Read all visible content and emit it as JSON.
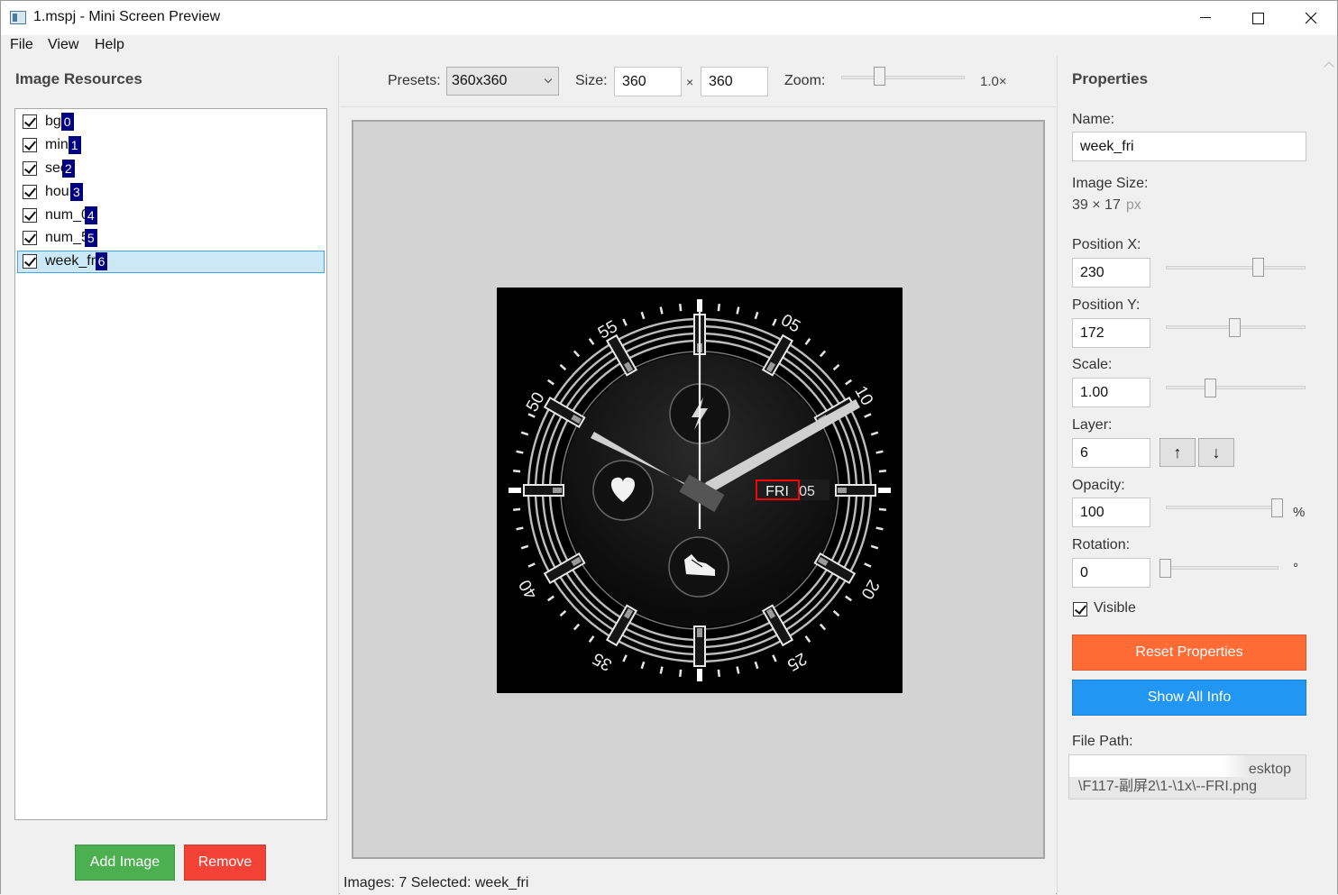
{
  "window": {
    "title": "1.mspj - Mini Screen Preview"
  },
  "menu": [
    "File",
    "View",
    "Help"
  ],
  "left_panel": {
    "title": "Image Resources",
    "items": [
      {
        "label": "bg",
        "index": "0",
        "checked": true
      },
      {
        "label": "min",
        "index": "1",
        "checked": true
      },
      {
        "label": "sec",
        "index": "2",
        "checked": true
      },
      {
        "label": "hour",
        "index": "3",
        "checked": true
      },
      {
        "label": "num_0",
        "index": "4",
        "checked": true
      },
      {
        "label": "num_5",
        "index": "5",
        "checked": true
      },
      {
        "label": "week_fri",
        "index": "6",
        "checked": true,
        "selected": true
      }
    ],
    "add_button": "Add Image",
    "remove_button": "Remove"
  },
  "toolbar": {
    "presets_label": "Presets:",
    "preset_value": "360x360",
    "size_label": "Size:",
    "width": "360",
    "times": "×",
    "height": "360",
    "zoom_label": "Zoom:",
    "zoom_value": "1.0×",
    "zoom_level": 0.3
  },
  "watch": {
    "minute_labels": [
      "05",
      "10",
      "20",
      "25",
      "35",
      "40",
      "50",
      "55"
    ],
    "date_day": "FRI",
    "date_num": "05"
  },
  "status": {
    "text": "Images: 7  Selected: week_fri"
  },
  "properties": {
    "title": "Properties",
    "name_label": "Name:",
    "name_value": "week_fri",
    "image_size_label": "Image Size:",
    "image_size_value": "39 × 17",
    "image_size_unit": "px",
    "pos_x_label": "Position X:",
    "pos_x_value": "230",
    "pos_y_label": "Position Y:",
    "pos_y_value": "172",
    "scale_label": "Scale:",
    "scale_value": "1.00",
    "layer_label": "Layer:",
    "layer_value": "6",
    "layer_up": "↑",
    "layer_down": "↓",
    "opacity_label": "Opacity:",
    "opacity_value": "100",
    "opacity_unit": "%",
    "rotation_label": "Rotation:",
    "rotation_value": "0",
    "rotation_unit": "°",
    "visible_label": "Visible",
    "reset_button": "Reset Properties",
    "show_info_button": "Show All Info",
    "file_path_label": "File Path:",
    "file_path_line1": "esktop",
    "file_path_line2": "\\F117-副屏2\\1-\\1x\\--FRI.png"
  },
  "colors": {
    "add": "#4caf50",
    "remove": "#f44336",
    "reset": "#ff6b35",
    "show_info": "#2196f3",
    "selection_badge": "#000080",
    "highlight": "#ff0000"
  }
}
